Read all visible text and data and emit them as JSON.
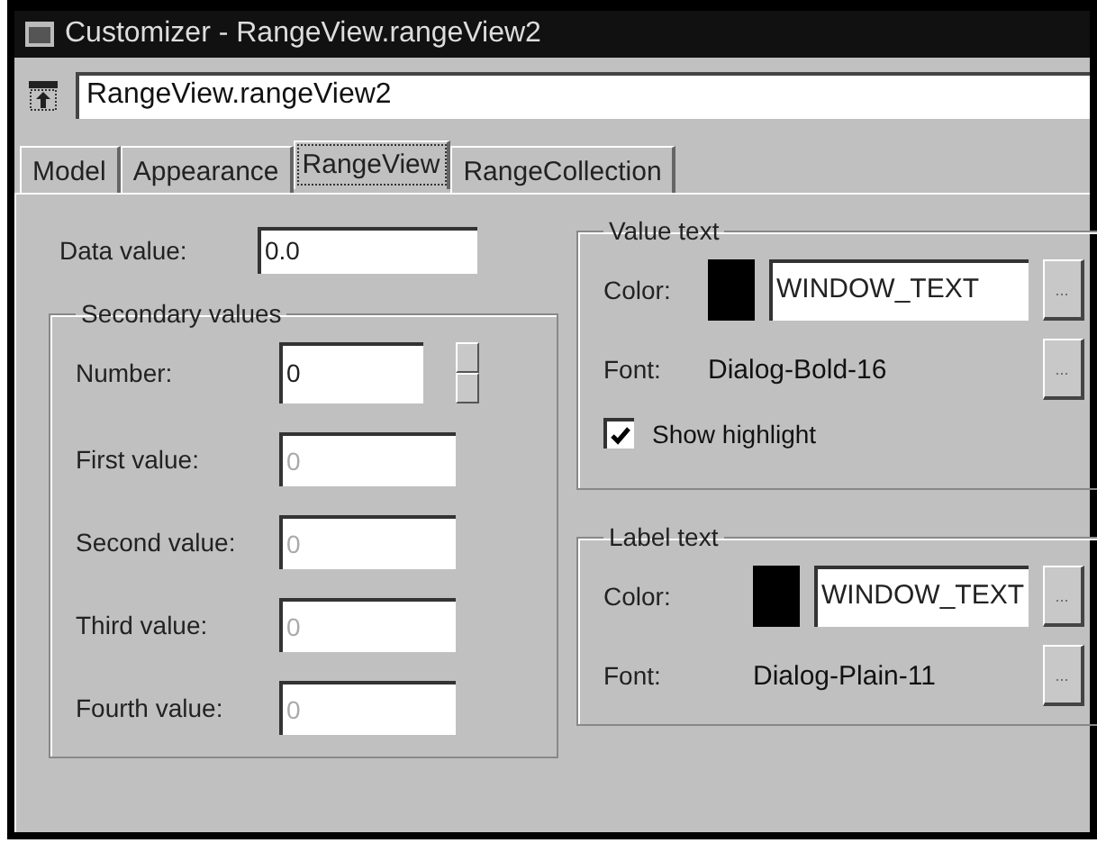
{
  "window": {
    "title": "Customizer - RangeView.rangeView2"
  },
  "object_field": {
    "value": "RangeView.rangeView2"
  },
  "tabs": [
    {
      "label": "Model",
      "selected": false
    },
    {
      "label": "Appearance",
      "selected": false
    },
    {
      "label": "RangeView",
      "selected": true
    },
    {
      "label": "RangeCollection",
      "selected": false
    }
  ],
  "data_value": {
    "label": "Data value:",
    "value": "0.0"
  },
  "secondary_values": {
    "title": "Secondary values",
    "number": {
      "label": "Number:",
      "value": "0"
    },
    "fields": [
      {
        "label": "First value:",
        "value": "0",
        "disabled": true
      },
      {
        "label": "Second value:",
        "value": "0",
        "disabled": true
      },
      {
        "label": "Third value:",
        "value": "0",
        "disabled": true
      },
      {
        "label": "Fourth value:",
        "value": "0",
        "disabled": true
      }
    ]
  },
  "text_groups": [
    {
      "title": "Value text",
      "color_label": "Color:",
      "color": "#000000",
      "color_value": "WINDOW_TEXT",
      "color_button": "...",
      "font_label": "Font:",
      "font_value": "Dialog-Bold-16",
      "font_button": "...",
      "highlight": {
        "label": "Show highlight",
        "checked": true
      }
    },
    {
      "title": "Label text",
      "color_label": "Color:",
      "color": "#000000",
      "color_value": "WINDOW_TEXT",
      "color_button": "...",
      "font_label": "Font:",
      "font_value": "Dialog-Plain-11",
      "font_button": "..."
    }
  ]
}
